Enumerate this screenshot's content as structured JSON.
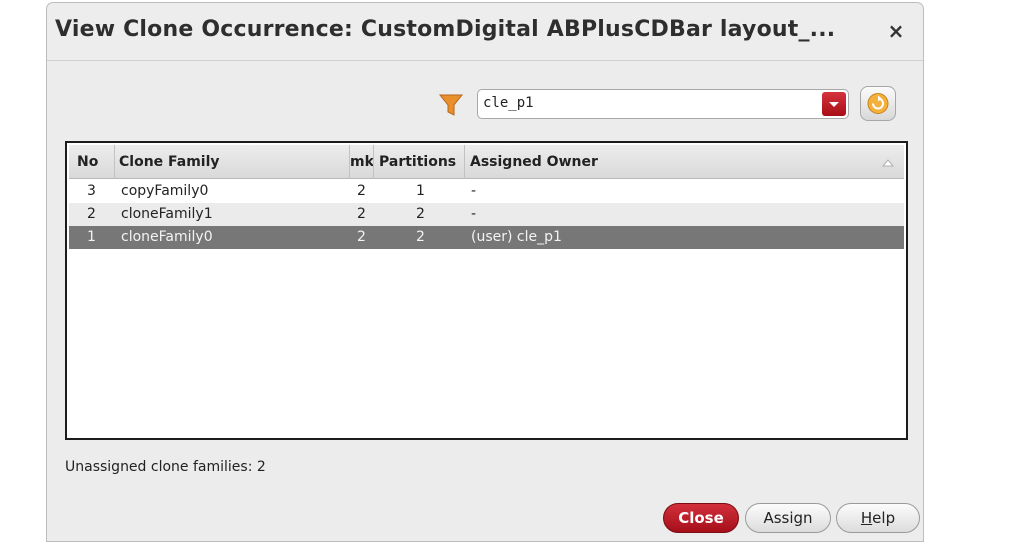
{
  "window": {
    "title": "View Clone Occurrence: CustomDigital ABPlusCDBar layout_...",
    "close_glyph": "×"
  },
  "filter": {
    "icon": "funnel-icon",
    "value": "cle_p1",
    "dropdown_icon": "chevron-down-icon",
    "refresh_icon": "refresh-icon"
  },
  "table": {
    "columns": {
      "no": "No",
      "clone_family": "Clone Family",
      "members": "mk",
      "partitions": "Partitions",
      "assigned_owner": "Assigned Owner"
    },
    "sort_icon": "sort-ascending-icon",
    "rows": [
      {
        "no": "3",
        "clone_family": "copyFamily0",
        "members": "2",
        "partitions": "1",
        "assigned_owner": "-"
      },
      {
        "no": "2",
        "clone_family": "cloneFamily1",
        "members": "2",
        "partitions": "2",
        "assigned_owner": "-"
      },
      {
        "no": "1",
        "clone_family": "cloneFamily0",
        "members": "2",
        "partitions": "2",
        "assigned_owner": "(user) cle_p1"
      }
    ],
    "selected_row": 2
  },
  "status": {
    "text": "Unassigned clone families: 2"
  },
  "buttons": {
    "close": "Close",
    "assign": "Assign",
    "help_mnemonic": "H",
    "help_rest": "elp"
  },
  "colors": {
    "accent_red": "#b51a24",
    "selected_row": "#777777",
    "filter_orange": "#e8902c"
  }
}
